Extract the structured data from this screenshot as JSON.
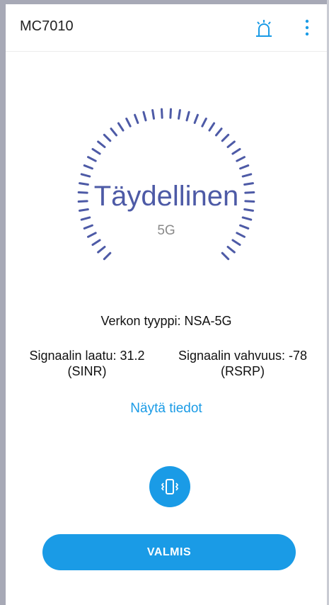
{
  "header": {
    "title": "MC7010"
  },
  "signal": {
    "quality": "Täydellinen",
    "network": "5G"
  },
  "info": {
    "network_type": "Verkon tyyppi: NSA-5G",
    "sinr_line1": "Signaalin laatu: 31.2",
    "sinr_line2": "(SINR)",
    "rsrp_line1": "Signaalin vahvuus: -78",
    "rsrp_line2": "(RSRP)"
  },
  "actions": {
    "details_link": "Näytä tiedot",
    "done_button": "VALMIS"
  },
  "icons": {
    "alarm": "alarm-light-icon",
    "menu": "more-vertical-icon",
    "vibrate": "vibrate-phone-icon"
  },
  "colors": {
    "accent": "#1a9be6",
    "gauge": "#4d5aa6"
  }
}
